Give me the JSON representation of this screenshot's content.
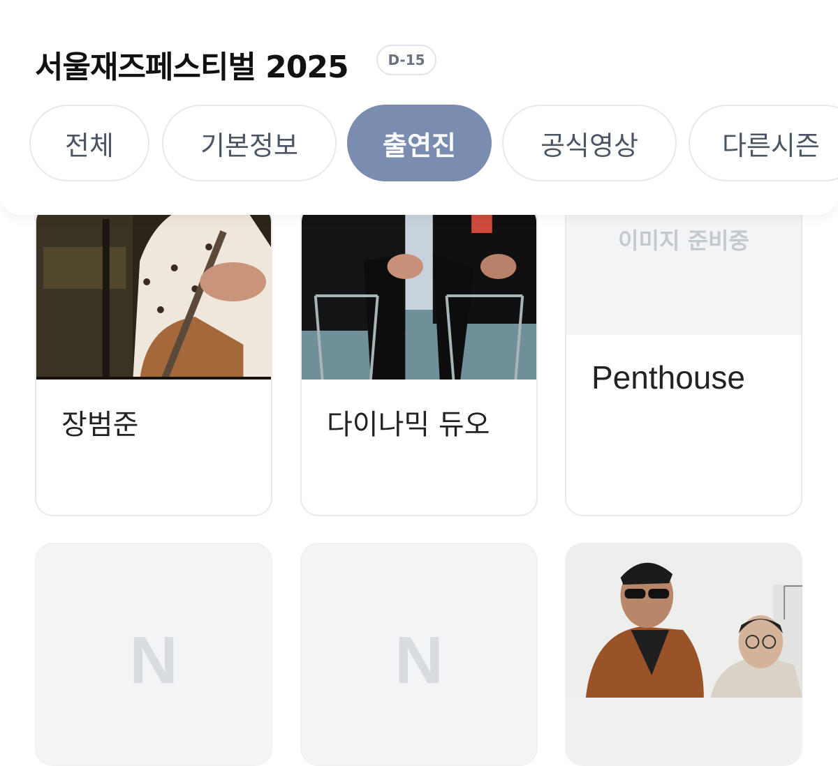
{
  "header": {
    "title": "서울재즈페스티벌 2025",
    "dday": "D-15"
  },
  "tabs": [
    {
      "label": "전체",
      "active": false
    },
    {
      "label": "기본정보",
      "active": false
    },
    {
      "label": "출연진",
      "active": true
    },
    {
      "label": "공식영상",
      "active": false
    },
    {
      "label": "다른시즌",
      "active": false
    }
  ],
  "lineup": [
    {
      "name": "장범준",
      "image": "photo"
    },
    {
      "name": "다이나믹 듀오",
      "image": "photo"
    },
    {
      "name": "Penthouse",
      "image": "placeholder",
      "placeholder_text": "이미지 준비중"
    },
    {
      "name": "",
      "image": "naver-logo",
      "logo_text": "N"
    },
    {
      "name": "",
      "image": "naver-logo",
      "logo_text": "N"
    },
    {
      "name": "",
      "image": "photo"
    }
  ],
  "colors": {
    "active_tab": "#7a8cb0",
    "placeholder_bg": "#f3f4f6"
  }
}
